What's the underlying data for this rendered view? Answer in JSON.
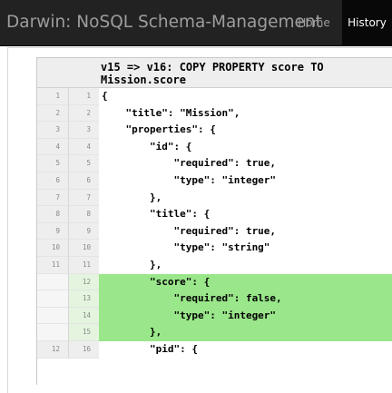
{
  "navbar": {
    "brand": "Darwin: NoSQL Schema-Management",
    "home": "Home",
    "history": "History"
  },
  "diff": {
    "title": "v15 => v16:  COPY PROPERTY score TO Mission.score",
    "rows": [
      {
        "old": "1",
        "new": "1",
        "code": "{",
        "added": false
      },
      {
        "old": "2",
        "new": "2",
        "code": "    \"title\": \"Mission\",",
        "added": false
      },
      {
        "old": "3",
        "new": "3",
        "code": "    \"properties\": {",
        "added": false
      },
      {
        "old": "4",
        "new": "4",
        "code": "        \"id\": {",
        "added": false
      },
      {
        "old": "5",
        "new": "5",
        "code": "            \"required\": true,",
        "added": false
      },
      {
        "old": "6",
        "new": "6",
        "code": "            \"type\": \"integer\"",
        "added": false
      },
      {
        "old": "7",
        "new": "7",
        "code": "        },",
        "added": false
      },
      {
        "old": "8",
        "new": "8",
        "code": "        \"title\": {",
        "added": false
      },
      {
        "old": "9",
        "new": "9",
        "code": "            \"required\": true,",
        "added": false
      },
      {
        "old": "10",
        "new": "10",
        "code": "            \"type\": \"string\"",
        "added": false
      },
      {
        "old": "11",
        "new": "11",
        "code": "        },",
        "added": false
      },
      {
        "old": "",
        "new": "12",
        "code": "        \"score\": {",
        "added": true
      },
      {
        "old": "",
        "new": "13",
        "code": "            \"required\": false,",
        "added": true
      },
      {
        "old": "",
        "new": "14",
        "code": "            \"type\": \"integer\"",
        "added": true
      },
      {
        "old": "",
        "new": "15",
        "code": "        },",
        "added": true
      },
      {
        "old": "12",
        "new": "16",
        "code": "        \"pid\": {",
        "added": false
      }
    ]
  },
  "colors": {
    "navbar_bg": "#222222",
    "navbar_active_bg": "#080808",
    "added_line_bg": "#9ae68a",
    "gutter_bg": "#eeeeee"
  }
}
